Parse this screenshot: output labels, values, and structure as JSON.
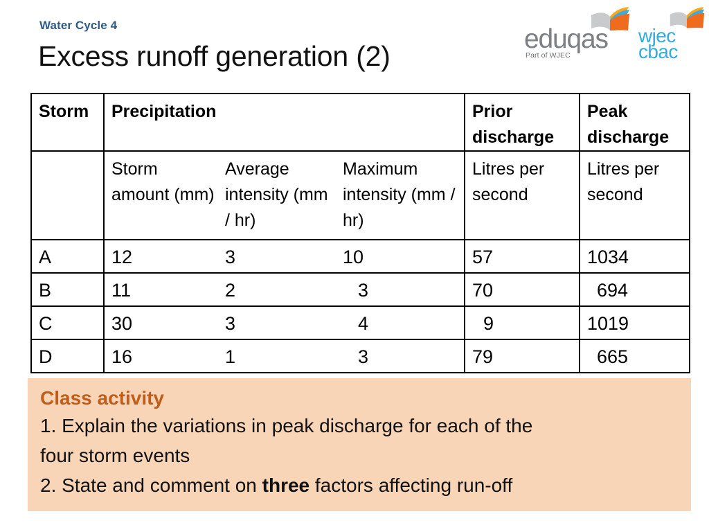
{
  "header": {
    "kicker": "Water Cycle 4",
    "title": "Excess runoff generation (2)"
  },
  "logos": {
    "eduqas": {
      "word": "eduqas",
      "subtitle": "Part of WJEC",
      "icon": "book-icon",
      "text_color": "#7C7F83"
    },
    "wjec": {
      "line1": "wjec",
      "line2": "cbac",
      "icon": "book-icon",
      "text_color": "#30ADE0"
    }
  },
  "table": {
    "header_top": {
      "storm": "Storm",
      "precipitation": "Precipitation",
      "blank_avg": "",
      "blank_max": "",
      "prior_discharge": "Prior discharge",
      "peak_discharge": "Peak discharge"
    },
    "header_sub": {
      "storm": "",
      "storm_amount": "Storm amount (mm)",
      "average_intensity": "Average intensity (mm / hr)",
      "maximum_intensity": "Maximum intensity (mm / hr)",
      "prior_units": "Litres per second",
      "peak_units": "Litres per second"
    },
    "rows": [
      {
        "storm": "A",
        "storm_amount": "12",
        "average_intensity": "3",
        "maximum_intensity": "10",
        "prior_discharge": "57",
        "peak_discharge": "1034"
      },
      {
        "storm": "B",
        "storm_amount": "11",
        "average_intensity": "2",
        "maximum_intensity": "3",
        "prior_discharge": "70",
        "peak_discharge": "694"
      },
      {
        "storm": "C",
        "storm_amount": "30",
        "average_intensity": "3",
        "maximum_intensity": "4",
        "prior_discharge": "9",
        "peak_discharge": "1019"
      },
      {
        "storm": "D",
        "storm_amount": "16",
        "average_intensity": "1",
        "maximum_intensity": "3",
        "prior_discharge": "79",
        "peak_discharge": "665"
      }
    ]
  },
  "class_activity": {
    "heading": "Class activity",
    "item1_line1": "1. Explain the variations in peak discharge for each of the",
    "item1_line2": "four storm events",
    "item2_prefix": "2. State and comment on ",
    "item2_bold": "three",
    "item2_suffix": " factors affecting run-off",
    "background_color": "#F9D5B8",
    "heading_color": "#BF5E1B"
  }
}
